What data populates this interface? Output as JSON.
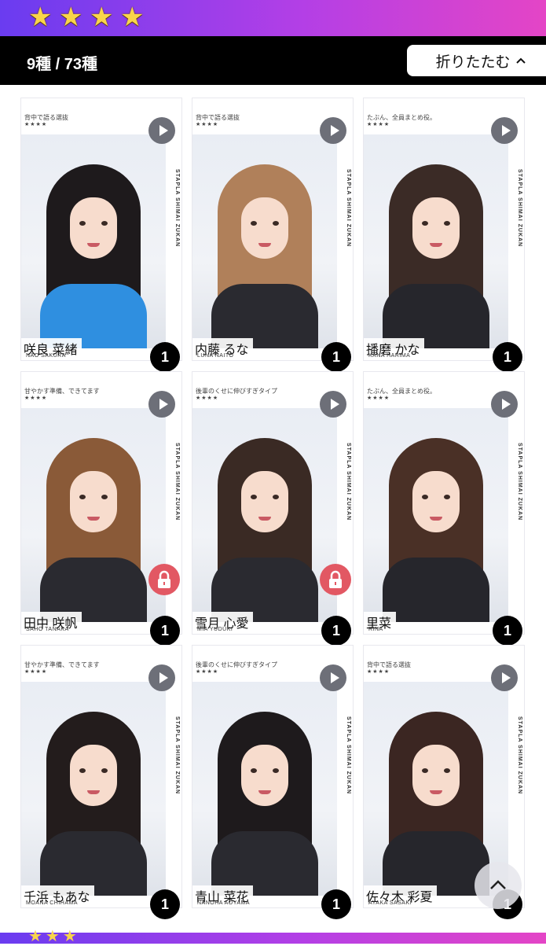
{
  "header": {
    "rarity_stars": [
      "★",
      "★",
      "★",
      "★"
    ],
    "star_color": "#f9d54a",
    "gradient": [
      "#6a3cf0",
      "#b33fe6",
      "#e445c6"
    ]
  },
  "count_bar": {
    "count_text": "9種 / 73種",
    "collapse_label": "折りたたむ",
    "collapse_icon": "chevron-up-icon"
  },
  "cards": [
    {
      "tagline": "背中で語る選抜",
      "stars": "★★★★",
      "side": "STAPLA SHIMAI ZUKAN",
      "name": "咲良 菜緒",
      "roman": "NAO SAKURA",
      "qty": "1",
      "locked": false,
      "hair": "#1e1a1c",
      "outfit": "#2f8fe0"
    },
    {
      "tagline": "背中で語る選抜",
      "stars": "★★★★",
      "side": "STAPLA SHIMAI ZUKAN",
      "name": "内藤 るな",
      "roman": "LUNA NAITO",
      "qty": "1",
      "locked": false,
      "hair": "#b0805a",
      "outfit": "#2a2a30"
    },
    {
      "tagline": "たぶん、全員まとめ役。",
      "stars": "★★★★",
      "side": "STAPLA SHIMAI ZUKAN",
      "name": "播磨 かな",
      "roman": "KANA HARIMA",
      "qty": "1",
      "locked": false,
      "hair": "#3b2b26",
      "outfit": "#26262c"
    },
    {
      "tagline": "甘やかす準備、できてます",
      "stars": "★★★★",
      "side": "STAPLA SHIMAI ZUKAN",
      "name": "田中 咲帆",
      "roman": "SAHO TANAKA",
      "qty": "1",
      "locked": true,
      "hair": "#8a5a38",
      "outfit": "#2a2a30"
    },
    {
      "tagline": "後輩のくせに伸びすぎタイプ",
      "stars": "★★★★",
      "side": "STAPLA SHIMAI ZUKAN",
      "name": "雪月 心愛",
      "roman": "MIA YUDUKI",
      "qty": "1",
      "locked": true,
      "hair": "#3a2a24",
      "outfit": "#2a2a30"
    },
    {
      "tagline": "たぶん、全員まとめ役。",
      "stars": "★★★★",
      "side": "STAPLA SHIMAI ZUKAN",
      "name": "里菜",
      "roman": "RINA",
      "qty": "1",
      "locked": false,
      "hair": "#4a3026",
      "outfit": "#26262c"
    },
    {
      "tagline": "甘やかす準備、できてます",
      "stars": "★★★★",
      "side": "STAPLA SHIMAI ZUKAN",
      "name": "千浜 もあな",
      "roman": "MOANA CHIHAMA",
      "qty": "1",
      "locked": false,
      "hair": "#231c1c",
      "outfit": "#2a2a30"
    },
    {
      "tagline": "後輩のくせに伸びすぎタイプ",
      "stars": "★★★★",
      "side": "STAPLA SHIMAI ZUKAN",
      "name": "青山 菜花",
      "roman": "NANOHA AOYAMA",
      "qty": "1",
      "locked": false,
      "hair": "#1e1a1c",
      "outfit": "#2a2a30"
    },
    {
      "tagline": "背中で語る選抜",
      "stars": "★★★★",
      "side": "STAPLA SHIMAI ZUKAN",
      "name": "佐々木 彩夏",
      "roman": "AYAKA SASAKI",
      "qty": "1",
      "locked": false,
      "hair": "#3b2622",
      "outfit": "#26262c"
    }
  ],
  "icons": {
    "play": "play-icon",
    "lock": "lock-icon",
    "scroll_top": "chevron-up-icon"
  },
  "colors": {
    "lock_badge": "#e25863",
    "play_button": "#6d6f78",
    "qty_badge": "#000000"
  }
}
